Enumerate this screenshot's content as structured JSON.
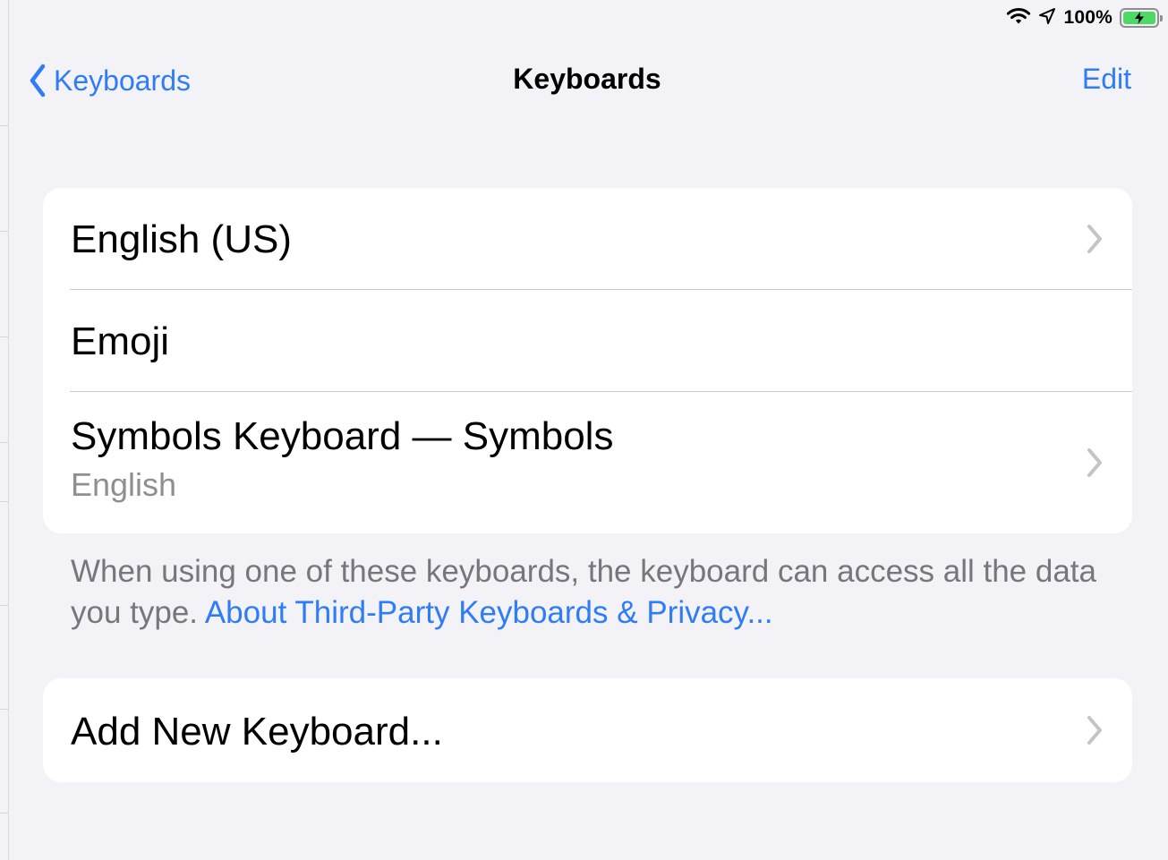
{
  "status_bar": {
    "wifi_icon": "wifi-icon",
    "location_icon": "location-arrow-icon",
    "battery_percent": "100%",
    "battery_level": 1.0,
    "charging": true,
    "battery_color": "#4cd964"
  },
  "nav": {
    "back_label": "Keyboards",
    "title": "Keyboards",
    "edit_label": "Edit"
  },
  "keyboards": {
    "items": [
      {
        "label": "English (US)",
        "has_chevron": true
      },
      {
        "label": "Emoji",
        "has_chevron": false
      },
      {
        "label": "Symbols Keyboard — Symbols",
        "sublabel": "English",
        "has_chevron": true
      }
    ]
  },
  "footer": {
    "text": "When using one of these keyboards, the keyboard can access all the data you type. ",
    "link": "About Third-Party Keyboards & Privacy..."
  },
  "add_keyboard": {
    "label": "Add New Keyboard..."
  },
  "colors": {
    "accent": "#2f7cf6",
    "background": "#f2f2f7",
    "secondary_text": "#8e8e93",
    "separator": "#c8c7cc"
  }
}
